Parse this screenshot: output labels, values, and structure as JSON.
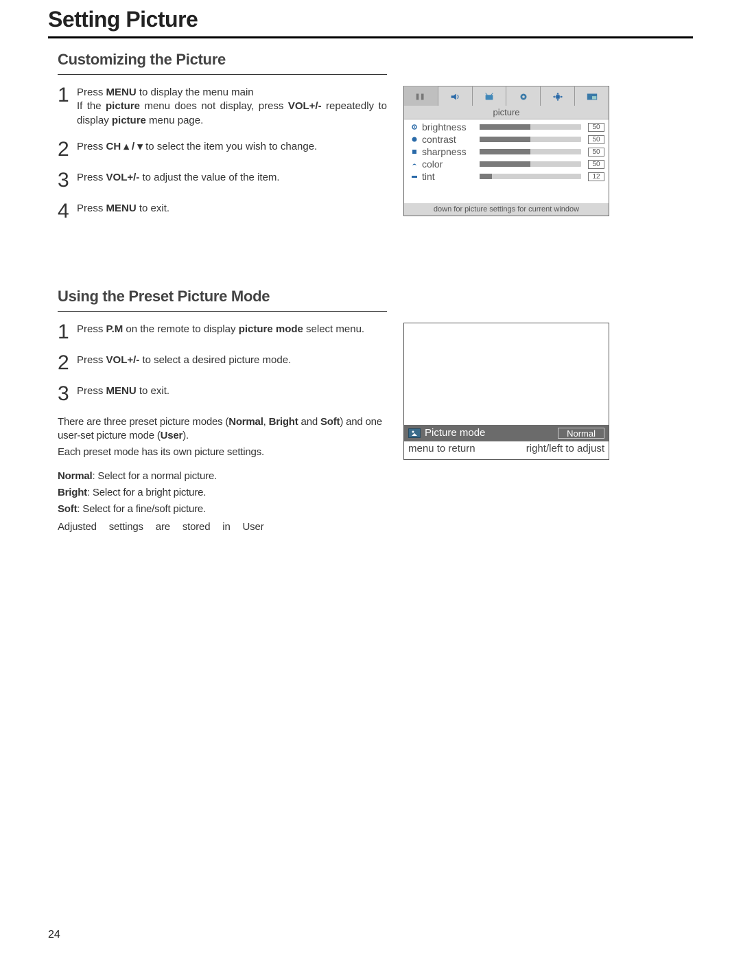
{
  "page_title": "Setting Picture",
  "page_number": "24",
  "section1": {
    "title": "Customizing the Picture",
    "steps": {
      "1": {
        "pre": "Press ",
        "b1": "MENU",
        "mid1": " to display the menu main",
        "line2a": "If the ",
        "b2": "picture",
        "line2b": " menu does not display, press ",
        "b3": "VOL+/-",
        "line3a": " repeatedly to display ",
        "b4": "picture",
        "line3b": " menu page."
      },
      "2": {
        "pre": "Press ",
        "b1": "CH ▴ / ▾",
        "post": " to select the item you wish to change."
      },
      "3": {
        "pre": "Press ",
        "b1": "VOL+/-",
        "post": " to adjust the value of the item."
      },
      "4": {
        "pre": "Press ",
        "b1": "MENU",
        "post": " to exit."
      }
    }
  },
  "osd": {
    "title": "picture",
    "rows": [
      {
        "label": "brightness",
        "value": "50",
        "fill": 50
      },
      {
        "label": "contrast",
        "value": "50",
        "fill": 50
      },
      {
        "label": "sharpness",
        "value": "50",
        "fill": 50
      },
      {
        "label": "color",
        "value": "50",
        "fill": 50
      },
      {
        "label": "tint",
        "value": "12",
        "fill": 12
      }
    ],
    "footer": "down for picture settings for current window"
  },
  "section2": {
    "title": "Using the Preset Picture Mode",
    "steps": {
      "1": {
        "pre": "Press ",
        "b1": "P.M",
        "mid": " on the remote to display ",
        "b2": "picture mode",
        "post": " select menu."
      },
      "2": {
        "pre": "Press ",
        "b1": "VOL+/-",
        "post": " to select a desired picture mode."
      },
      "3": {
        "pre": "Press ",
        "b1": "MENU",
        "post": " to exit."
      }
    },
    "para1a": "There are three preset picture modes (",
    "para1b": "Normal",
    "para1c": ", ",
    "para1d": "Bright",
    "para1e": " and ",
    "para1f": "Soft",
    "para1g": ") and one user-set picture mode (",
    "para1h": "User",
    "para1i": ").",
    "para2": "Each preset mode has its own picture settings.",
    "desc": {
      "normal_b": "Normal",
      "normal_t": ": Select for a normal picture.",
      "bright_b": "Bright",
      "bright_t": ": Select for a bright picture.",
      "soft_b": "Soft",
      "soft_t": ": Select for a fine/soft picture."
    },
    "para3": "Adjusted settings are stored in User"
  },
  "pm_panel": {
    "label": "Picture mode",
    "value": "Normal",
    "hint_left": "menu to return",
    "hint_right": "right/left to adjust"
  }
}
